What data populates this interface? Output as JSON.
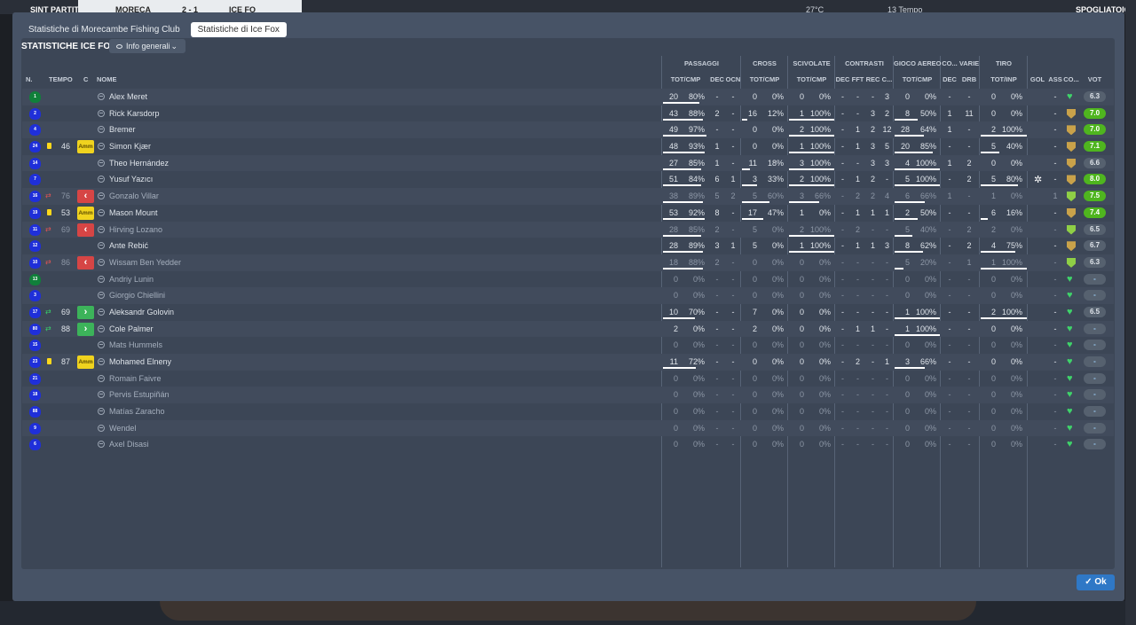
{
  "background": {
    "items": [
      "SINT PARTITA",
      "MORECA",
      "2 - 1",
      "ICE FO",
      "27°C",
      "13 Tempo",
      "SPOGLIATOIO"
    ]
  },
  "tabs": [
    {
      "label": "Statistiche di Morecambe Fishing Club",
      "active": false
    },
    {
      "label": "Statistiche di Ice Fox",
      "active": true
    }
  ],
  "panel_title": "STATISTICHE ICE FOX",
  "view_select": {
    "label": "Info generali"
  },
  "group_headers": [
    "PASSAGGI",
    "CROSS",
    "SCIVOLATE",
    "CONTRASTI",
    "GIOCO AEREO",
    "CO...",
    "VARIE",
    "TIRO"
  ],
  "columns": {
    "num": "N.",
    "time": "TEMPO",
    "c": "C",
    "name": "NOME",
    "pass": "TOT/CMP",
    "dec": "DEC",
    "ocn": "OCN",
    "cross": "TOT/CMP",
    "tack": "TOT/CMP",
    "cdec": "DEC",
    "fft": "FFT",
    "rec": "REC",
    "cc": "C...",
    "aer": "TOT/CMP",
    "codec": "DEC",
    "drb": "DRB",
    "shot": "TOT/INP",
    "gol": "GOL",
    "ass": "ASS",
    "co": "CO...",
    "vot": "VOT"
  },
  "players": [
    {
      "num": "1",
      "gk": true,
      "name": "Alex Meret",
      "sub": false,
      "card": "",
      "ev": "",
      "time": "",
      "tag": "",
      "pt": "20",
      "pp": "80%",
      "pd": "-",
      "po": "-",
      "ct": "0",
      "cp": "0%",
      "st": "0",
      "sp": "0%",
      "cdec": "-",
      "fft": "-",
      "rec": "-",
      "cc": "3",
      "at": "0",
      "ap": "0%",
      "codec": "-",
      "drb": "-",
      "tt": "0",
      "tp": "0%",
      "gol": "",
      "ass": "-",
      "co": "heart",
      "vot": "6.3",
      "vc": "mid"
    },
    {
      "num": "2",
      "gk": false,
      "name": "Rick Karsdorp",
      "sub": false,
      "card": "",
      "ev": "",
      "time": "",
      "tag": "",
      "pt": "43",
      "pp": "88%",
      "pd": "2",
      "po": "-",
      "ct": "16",
      "cp": "12%",
      "st": "1",
      "sp": "100%",
      "cdec": "-",
      "fft": "-",
      "rec": "3",
      "cc": "2",
      "at": "8",
      "ap": "50%",
      "codec": "1",
      "drb": "11",
      "tt": "0",
      "tp": "0%",
      "gol": "",
      "ass": "-",
      "co": "shield",
      "vot": "7.0",
      "vc": "hi"
    },
    {
      "num": "4",
      "gk": false,
      "name": "Bremer",
      "sub": false,
      "card": "",
      "ev": "",
      "time": "",
      "tag": "",
      "pt": "49",
      "pp": "97%",
      "pd": "-",
      "po": "-",
      "ct": "0",
      "cp": "0%",
      "st": "2",
      "sp": "100%",
      "cdec": "-",
      "fft": "1",
      "rec": "2",
      "cc": "12",
      "at": "28",
      "ap": "64%",
      "codec": "1",
      "drb": "-",
      "tt": "2",
      "tp": "100%",
      "gol": "",
      "ass": "-",
      "co": "shield",
      "vot": "7.0",
      "vc": "hi"
    },
    {
      "num": "24",
      "gk": false,
      "name": "Simon Kjær",
      "sub": false,
      "card": "y",
      "ev": "",
      "time": "46",
      "tag": "Amm",
      "pt": "48",
      "pp": "93%",
      "pd": "1",
      "po": "-",
      "ct": "0",
      "cp": "0%",
      "st": "1",
      "sp": "100%",
      "cdec": "-",
      "fft": "1",
      "rec": "3",
      "cc": "5",
      "at": "20",
      "ap": "85%",
      "codec": "-",
      "drb": "-",
      "tt": "5",
      "tp": "40%",
      "gol": "",
      "ass": "-",
      "co": "shield",
      "vot": "7.1",
      "vc": "hi"
    },
    {
      "num": "14",
      "gk": false,
      "name": "Theo Hernández",
      "sub": false,
      "card": "",
      "ev": "",
      "time": "",
      "tag": "",
      "pt": "27",
      "pp": "85%",
      "pd": "1",
      "po": "-",
      "ct": "11",
      "cp": "18%",
      "st": "3",
      "sp": "100%",
      "cdec": "-",
      "fft": "-",
      "rec": "3",
      "cc": "3",
      "at": "4",
      "ap": "100%",
      "codec": "1",
      "drb": "2",
      "tt": "0",
      "tp": "0%",
      "gol": "",
      "ass": "-",
      "co": "shield",
      "vot": "6.6",
      "vc": "mid"
    },
    {
      "num": "7",
      "gk": false,
      "name": "Yusuf Yazıcı",
      "sub": false,
      "card": "",
      "ev": "",
      "time": "",
      "tag": "",
      "pt": "51",
      "pp": "84%",
      "pd": "6",
      "po": "1",
      "ct": "3",
      "cp": "33%",
      "st": "2",
      "sp": "100%",
      "cdec": "-",
      "fft": "1",
      "rec": "2",
      "cc": "-",
      "at": "5",
      "ap": "100%",
      "codec": "-",
      "drb": "2",
      "tt": "5",
      "tp": "80%",
      "gol": "gear",
      "ass": "-",
      "co": "shield",
      "vot": "8.0",
      "vc": "hi"
    },
    {
      "num": "16",
      "gk": false,
      "name": "Gonzalo Villar",
      "sub": true,
      "card": "",
      "ev": "out",
      "time": "76",
      "tag": "out",
      "pt": "38",
      "pp": "89%",
      "pd": "5",
      "po": "2",
      "ct": "5",
      "cp": "60%",
      "st": "3",
      "sp": "66%",
      "cdec": "-",
      "fft": "2",
      "rec": "2",
      "cc": "4",
      "at": "6",
      "ap": "66%",
      "codec": "1",
      "drb": "-",
      "tt": "1",
      "tp": "0%",
      "gol": "",
      "ass": "1",
      "co": "shieldg",
      "vot": "7.5",
      "vc": "hi"
    },
    {
      "num": "19",
      "gk": false,
      "name": "Mason Mount",
      "sub": false,
      "card": "y",
      "ev": "",
      "time": "53",
      "tag": "Amm",
      "pt": "53",
      "pp": "92%",
      "pd": "8",
      "po": "-",
      "ct": "17",
      "cp": "47%",
      "st": "1",
      "sp": "0%",
      "cdec": "-",
      "fft": "1",
      "rec": "1",
      "cc": "1",
      "at": "2",
      "ap": "50%",
      "codec": "-",
      "drb": "-",
      "tt": "6",
      "tp": "16%",
      "gol": "",
      "ass": "-",
      "co": "shield",
      "vot": "7.4",
      "vc": "hi"
    },
    {
      "num": "11",
      "gk": false,
      "name": "Hirving Lozano",
      "sub": true,
      "card": "",
      "ev": "out",
      "time": "69",
      "tag": "out",
      "pt": "28",
      "pp": "85%",
      "pd": "2",
      "po": "-",
      "ct": "5",
      "cp": "0%",
      "st": "2",
      "sp": "100%",
      "cdec": "-",
      "fft": "2",
      "rec": "-",
      "cc": "-",
      "at": "5",
      "ap": "40%",
      "codec": "-",
      "drb": "2",
      "tt": "2",
      "tp": "0%",
      "gol": "",
      "ass": "-",
      "co": "shieldg",
      "vot": "6.5",
      "vc": "mid"
    },
    {
      "num": "12",
      "gk": false,
      "name": "Ante Rebić",
      "sub": false,
      "card": "",
      "ev": "",
      "time": "",
      "tag": "",
      "pt": "28",
      "pp": "89%",
      "pd": "3",
      "po": "1",
      "ct": "5",
      "cp": "0%",
      "st": "1",
      "sp": "100%",
      "cdec": "-",
      "fft": "1",
      "rec": "1",
      "cc": "3",
      "at": "8",
      "ap": "62%",
      "codec": "-",
      "drb": "2",
      "tt": "4",
      "tp": "75%",
      "gol": "",
      "ass": "-",
      "co": "shield",
      "vot": "6.7",
      "vc": "mid"
    },
    {
      "num": "10",
      "gk": false,
      "name": "Wissam Ben Yedder",
      "sub": true,
      "card": "",
      "ev": "out",
      "time": "86",
      "tag": "out",
      "pt": "18",
      "pp": "88%",
      "pd": "2",
      "po": "-",
      "ct": "0",
      "cp": "0%",
      "st": "0",
      "sp": "0%",
      "cdec": "-",
      "fft": "-",
      "rec": "-",
      "cc": "-",
      "at": "5",
      "ap": "20%",
      "codec": "-",
      "drb": "1",
      "tt": "1",
      "tp": "100%",
      "gol": "",
      "ass": "-",
      "co": "shieldg",
      "vot": "6.3",
      "vc": "mid"
    },
    {
      "num": "13",
      "gk": true,
      "name": "Andriy Lunin",
      "sub": true,
      "card": "",
      "ev": "",
      "time": "",
      "tag": "",
      "pt": "0",
      "pp": "0%",
      "pd": "-",
      "po": "-",
      "ct": "0",
      "cp": "0%",
      "st": "0",
      "sp": "0%",
      "cdec": "-",
      "fft": "-",
      "rec": "-",
      "cc": "-",
      "at": "0",
      "ap": "0%",
      "codec": "-",
      "drb": "-",
      "tt": "0",
      "tp": "0%",
      "gol": "",
      "ass": "-",
      "co": "heart",
      "vot": "-",
      "vc": "none"
    },
    {
      "num": "3",
      "gk": false,
      "name": "Giorgio Chiellini",
      "sub": true,
      "card": "",
      "ev": "",
      "time": "",
      "tag": "",
      "pt": "0",
      "pp": "0%",
      "pd": "-",
      "po": "-",
      "ct": "0",
      "cp": "0%",
      "st": "0",
      "sp": "0%",
      "cdec": "-",
      "fft": "-",
      "rec": "-",
      "cc": "-",
      "at": "0",
      "ap": "0%",
      "codec": "-",
      "drb": "-",
      "tt": "0",
      "tp": "0%",
      "gol": "",
      "ass": "-",
      "co": "heart",
      "vot": "-",
      "vc": "none"
    },
    {
      "num": "17",
      "gk": false,
      "name": "Aleksandr Golovin",
      "sub": false,
      "card": "",
      "ev": "in",
      "time": "69",
      "tag": "in",
      "pt": "10",
      "pp": "70%",
      "pd": "-",
      "po": "-",
      "ct": "7",
      "cp": "0%",
      "st": "0",
      "sp": "0%",
      "cdec": "-",
      "fft": "-",
      "rec": "-",
      "cc": "-",
      "at": "1",
      "ap": "100%",
      "codec": "-",
      "drb": "-",
      "tt": "2",
      "tp": "100%",
      "gol": "",
      "ass": "-",
      "co": "heart",
      "vot": "6.5",
      "vc": "mid"
    },
    {
      "num": "80",
      "gk": false,
      "name": "Cole Palmer",
      "sub": false,
      "card": "",
      "ev": "in",
      "time": "88",
      "tag": "in",
      "pt": "2",
      "pp": "0%",
      "pd": "-",
      "po": "-",
      "ct": "2",
      "cp": "0%",
      "st": "0",
      "sp": "0%",
      "cdec": "-",
      "fft": "1",
      "rec": "1",
      "cc": "-",
      "at": "1",
      "ap": "100%",
      "codec": "-",
      "drb": "-",
      "tt": "0",
      "tp": "0%",
      "gol": "",
      "ass": "-",
      "co": "heart",
      "vot": "-",
      "vc": "none"
    },
    {
      "num": "15",
      "gk": false,
      "name": "Mats Hummels",
      "sub": true,
      "card": "",
      "ev": "",
      "time": "",
      "tag": "",
      "pt": "0",
      "pp": "0%",
      "pd": "-",
      "po": "-",
      "ct": "0",
      "cp": "0%",
      "st": "0",
      "sp": "0%",
      "cdec": "-",
      "fft": "-",
      "rec": "-",
      "cc": "-",
      "at": "0",
      "ap": "0%",
      "codec": "-",
      "drb": "-",
      "tt": "0",
      "tp": "0%",
      "gol": "",
      "ass": "-",
      "co": "heart",
      "vot": "-",
      "vc": "none"
    },
    {
      "num": "23",
      "gk": false,
      "name": "Mohamed Elneny",
      "sub": false,
      "card": "y",
      "ev": "",
      "time": "87",
      "tag": "Amm",
      "pt": "11",
      "pp": "72%",
      "pd": "-",
      "po": "-",
      "ct": "0",
      "cp": "0%",
      "st": "0",
      "sp": "0%",
      "cdec": "-",
      "fft": "2",
      "rec": "-",
      "cc": "1",
      "at": "3",
      "ap": "66%",
      "codec": "-",
      "drb": "-",
      "tt": "0",
      "tp": "0%",
      "gol": "",
      "ass": "-",
      "co": "heart",
      "vot": "-",
      "vc": "none"
    },
    {
      "num": "21",
      "gk": false,
      "name": "Romain Faivre",
      "sub": true,
      "card": "",
      "ev": "",
      "time": "",
      "tag": "",
      "pt": "0",
      "pp": "0%",
      "pd": "-",
      "po": "-",
      "ct": "0",
      "cp": "0%",
      "st": "0",
      "sp": "0%",
      "cdec": "-",
      "fft": "-",
      "rec": "-",
      "cc": "-",
      "at": "0",
      "ap": "0%",
      "codec": "-",
      "drb": "-",
      "tt": "0",
      "tp": "0%",
      "gol": "",
      "ass": "-",
      "co": "heart",
      "vot": "-",
      "vc": "none"
    },
    {
      "num": "18",
      "gk": false,
      "name": "Pervis Estupiñán",
      "sub": true,
      "card": "",
      "ev": "",
      "time": "",
      "tag": "",
      "pt": "0",
      "pp": "0%",
      "pd": "-",
      "po": "-",
      "ct": "0",
      "cp": "0%",
      "st": "0",
      "sp": "0%",
      "cdec": "-",
      "fft": "-",
      "rec": "-",
      "cc": "-",
      "at": "0",
      "ap": "0%",
      "codec": "-",
      "drb": "-",
      "tt": "0",
      "tp": "0%",
      "gol": "",
      "ass": "-",
      "co": "heart",
      "vot": "-",
      "vc": "none"
    },
    {
      "num": "88",
      "gk": false,
      "name": "Matías Zaracho",
      "sub": true,
      "card": "",
      "ev": "",
      "time": "",
      "tag": "",
      "pt": "0",
      "pp": "0%",
      "pd": "-",
      "po": "-",
      "ct": "0",
      "cp": "0%",
      "st": "0",
      "sp": "0%",
      "cdec": "-",
      "fft": "-",
      "rec": "-",
      "cc": "-",
      "at": "0",
      "ap": "0%",
      "codec": "-",
      "drb": "-",
      "tt": "0",
      "tp": "0%",
      "gol": "",
      "ass": "-",
      "co": "heart",
      "vot": "-",
      "vc": "none"
    },
    {
      "num": "9",
      "gk": false,
      "name": "Wendel",
      "sub": true,
      "card": "",
      "ev": "",
      "time": "",
      "tag": "",
      "pt": "0",
      "pp": "0%",
      "pd": "-",
      "po": "-",
      "ct": "0",
      "cp": "0%",
      "st": "0",
      "sp": "0%",
      "cdec": "-",
      "fft": "-",
      "rec": "-",
      "cc": "-",
      "at": "0",
      "ap": "0%",
      "codec": "-",
      "drb": "-",
      "tt": "0",
      "tp": "0%",
      "gol": "",
      "ass": "-",
      "co": "heart",
      "vot": "-",
      "vc": "none"
    },
    {
      "num": "6",
      "gk": false,
      "name": "Axel Disasi",
      "sub": true,
      "card": "",
      "ev": "",
      "time": "",
      "tag": "",
      "pt": "0",
      "pp": "0%",
      "pd": "-",
      "po": "-",
      "ct": "0",
      "cp": "0%",
      "st": "0",
      "sp": "0%",
      "cdec": "-",
      "fft": "-",
      "rec": "-",
      "cc": "-",
      "at": "0",
      "ap": "0%",
      "codec": "-",
      "drb": "-",
      "tt": "0",
      "tp": "0%",
      "gol": "",
      "ass": "-",
      "co": "heart",
      "vot": "-",
      "vc": "none"
    }
  ],
  "ok_button": "Ok"
}
